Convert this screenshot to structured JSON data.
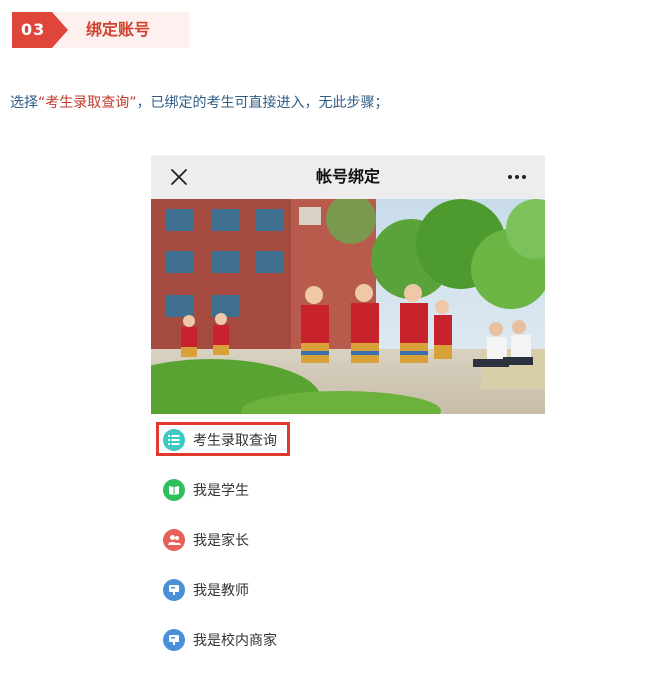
{
  "step": {
    "number": "03",
    "title": "绑定账号"
  },
  "instruction": {
    "prefix": "选择",
    "quote_open": "“",
    "highlight": "考生录取查询",
    "quote_close": "”",
    "suffix": "，已绑定的考生可直接进入，无此步骤；"
  },
  "phone": {
    "nav_title": "帐号绑定",
    "menu": [
      {
        "label": "考生录取查询",
        "icon": "list-icon",
        "color": "#3ec8c3",
        "highlighted": true
      },
      {
        "label": "我是学生",
        "icon": "book-icon",
        "color": "#2fbf5d"
      },
      {
        "label": "我是家长",
        "icon": "people-icon",
        "color": "#e5615a"
      },
      {
        "label": "我是教师",
        "icon": "teacher-icon",
        "color": "#4a90d9"
      },
      {
        "label": "我是校内商家",
        "icon": "shop-icon",
        "color": "#4a90d9"
      }
    ]
  },
  "colors": {
    "accent": "#e0453a",
    "instruction_text": "#2f5d86",
    "highlight_text": "#c0392b"
  }
}
